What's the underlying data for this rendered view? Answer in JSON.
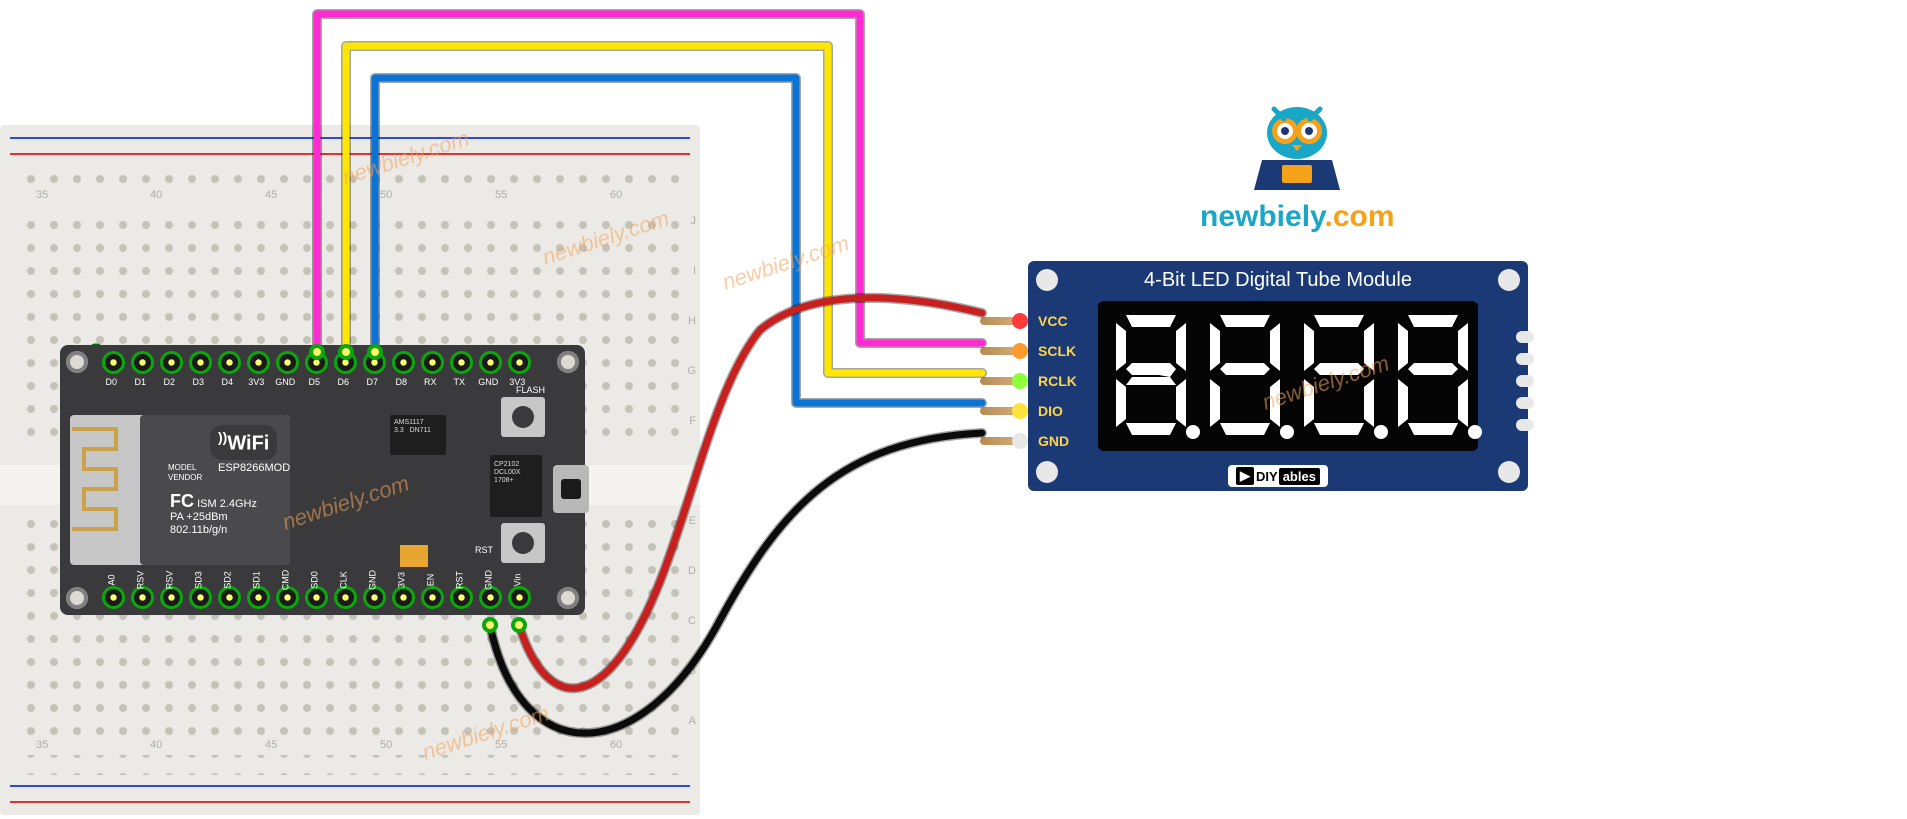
{
  "brand": {
    "site": "newbiely",
    "tld": ".com"
  },
  "module": {
    "title": "4-Bit LED Digital Tube Module",
    "pins": [
      "VCC",
      "SCLK",
      "RCLK",
      "DIO",
      "GND"
    ],
    "logo_prefix": "DIY",
    "logo_suffix": "ables"
  },
  "esp": {
    "wifi_label": "WiFi",
    "model_label": "MODEL\nVENDOR",
    "chip_label": "ESP8266MOD",
    "spec_lines": "ISM 2.4GHz\nPA +25dBm\n802.11b/g/n",
    "fcc_label": "FC",
    "regulator_label": "AMS1117\n3.3   DN711",
    "usb_chip_label": "CP2102\nDCL00X\n1708+",
    "buttons": {
      "flash": "FLASH",
      "rst": "RST"
    },
    "pins_top": [
      "D0",
      "D1",
      "D2",
      "D3",
      "D4",
      "3V3",
      "GND",
      "D5",
      "D6",
      "D7",
      "D8",
      "RX",
      "TX",
      "GND",
      "3V3"
    ],
    "pins_bottom": [
      "A0",
      "RSV",
      "RSV",
      "SD3",
      "SD2",
      "SD1",
      "CMD",
      "SD0",
      "CLK",
      "GND",
      "3V3",
      "EN",
      "RST",
      "GND",
      "Vin"
    ]
  },
  "wiring": {
    "magenta": {
      "from": "ESP8266 D5",
      "to": "Module SCLK",
      "color": "#ff2ad1"
    },
    "yellow": {
      "from": "ESP8266 D6",
      "to": "Module RCLK",
      "color": "#ffe600"
    },
    "blue": {
      "from": "ESP8266 D7",
      "to": "Module DIO",
      "color": "#0a74d6"
    },
    "red": {
      "from": "ESP8266 Vin",
      "to": "Module VCC",
      "color": "#c81f1f"
    },
    "black": {
      "from": "ESP8266 GND",
      "to": "Module GND",
      "color": "#0b0b0b"
    }
  },
  "breadboard": {
    "columns": [
      "35",
      "40",
      "45",
      "50",
      "55",
      "60"
    ],
    "rows_top": [
      "J",
      "I",
      "H",
      "G",
      "F"
    ],
    "rows_bot": [
      "E",
      "D",
      "C",
      "B",
      "A"
    ]
  },
  "watermarks": [
    "newbiely.com",
    "newbiely.com",
    "newbiely.com",
    "newbiely.com",
    "newbiely.com"
  ]
}
